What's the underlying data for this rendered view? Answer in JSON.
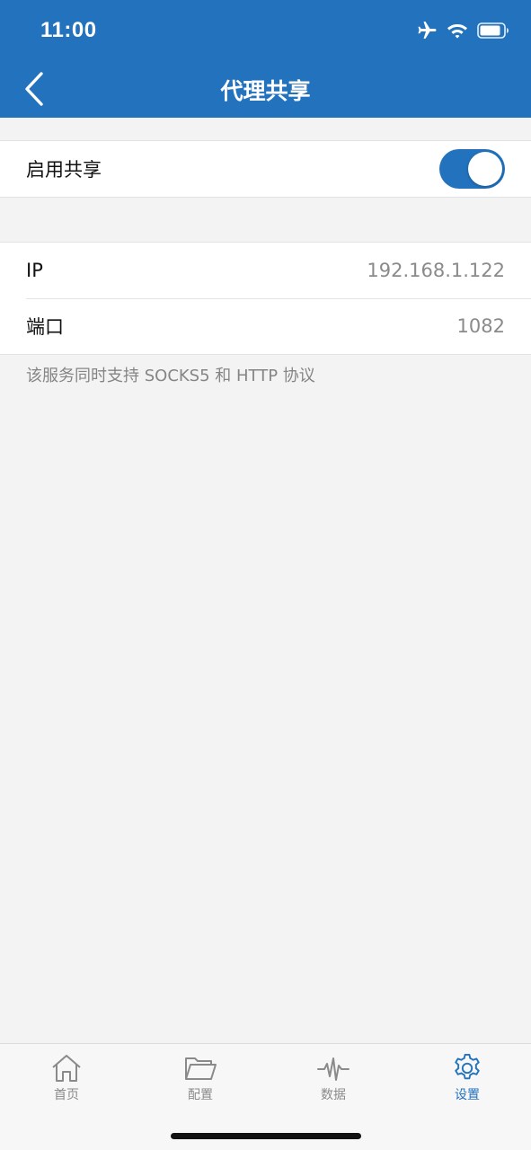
{
  "status_bar": {
    "time": "11:00",
    "icons": [
      "airplane-icon",
      "wifi-icon",
      "battery-icon"
    ]
  },
  "nav": {
    "title": "代理共享",
    "back_icon": "chevron-left-icon"
  },
  "sharing": {
    "label": "启用共享",
    "enabled": true
  },
  "info": {
    "rows": [
      {
        "label": "IP",
        "value": "192.168.1.122"
      },
      {
        "label": "端口",
        "value": "1082"
      }
    ],
    "footnote": "该服务同时支持 SOCKS5 和 HTTP 协议"
  },
  "tabbar": {
    "tabs": [
      {
        "label": "首页",
        "icon": "home-icon",
        "active": false
      },
      {
        "label": "配置",
        "icon": "folder-icon",
        "active": false
      },
      {
        "label": "数据",
        "icon": "activity-icon",
        "active": false
      },
      {
        "label": "设置",
        "icon": "gear-icon",
        "active": true
      }
    ]
  },
  "colors": {
    "accent": "#2272bd",
    "background": "#f3f3f3",
    "secondary_text": "#8a8a8a"
  }
}
